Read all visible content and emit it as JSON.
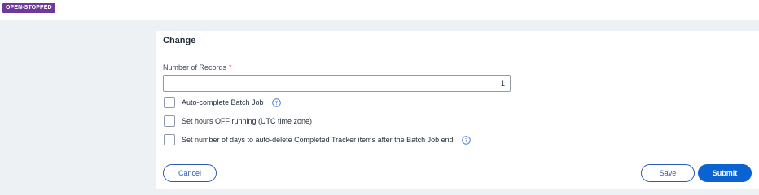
{
  "header": {
    "status_badge": "OPEN-STOPPED"
  },
  "form": {
    "title": "Change",
    "records_label": "Number of Records",
    "required_marker": "*",
    "records_value": "1",
    "options": [
      {
        "label": "Auto-complete Batch Job",
        "checked": false,
        "has_help": true
      },
      {
        "label": "Set hours OFF running (UTC time zone)",
        "checked": false,
        "has_help": false
      },
      {
        "label": "Set number of days to auto-delete Completed Tracker items after the Batch Job end",
        "checked": false,
        "has_help": true
      }
    ]
  },
  "actions": {
    "cancel_label": "Cancel",
    "save_label": "Save",
    "submit_label": "Submit"
  },
  "colors": {
    "badge": "#6d3a9c",
    "primary": "#0a63d1",
    "outline": "#2d5ab8",
    "required": "#d62c2c",
    "help_icon": "#4a7fd0"
  }
}
